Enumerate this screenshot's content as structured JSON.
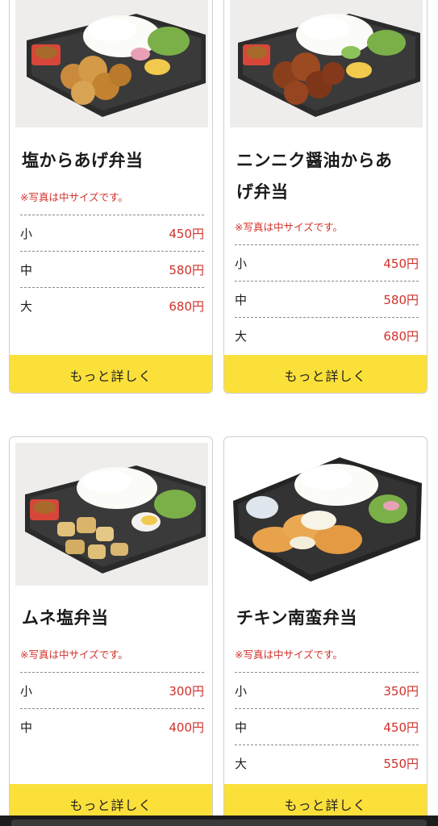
{
  "note_text": "※写真は中サイズです。",
  "button_label": "もっと詳しく",
  "colors": {
    "price": "#d0312b",
    "button": "#fbe03a"
  },
  "products": [
    {
      "title_line1": "塩からあげ弁当",
      "title_line2": "",
      "sizes": [
        {
          "size": "小",
          "price": "450円"
        },
        {
          "size": "中",
          "price": "580円"
        },
        {
          "size": "大",
          "price": "680円"
        }
      ]
    },
    {
      "title_line1": "ニンニク醤油からあ",
      "title_line2": "げ弁当",
      "sizes": [
        {
          "size": "小",
          "price": "450円"
        },
        {
          "size": "中",
          "price": "580円"
        },
        {
          "size": "大",
          "price": "680円"
        }
      ]
    },
    {
      "title_line1": "ムネ塩弁当",
      "title_line2": "",
      "sizes": [
        {
          "size": "小",
          "price": "300円"
        },
        {
          "size": "中",
          "price": "400円"
        }
      ]
    },
    {
      "title_line1": "チキン南蛮弁当",
      "title_line2": "",
      "sizes": [
        {
          "size": "小",
          "price": "350円"
        },
        {
          "size": "中",
          "price": "450円"
        },
        {
          "size": "大",
          "price": "550円"
        }
      ]
    }
  ]
}
